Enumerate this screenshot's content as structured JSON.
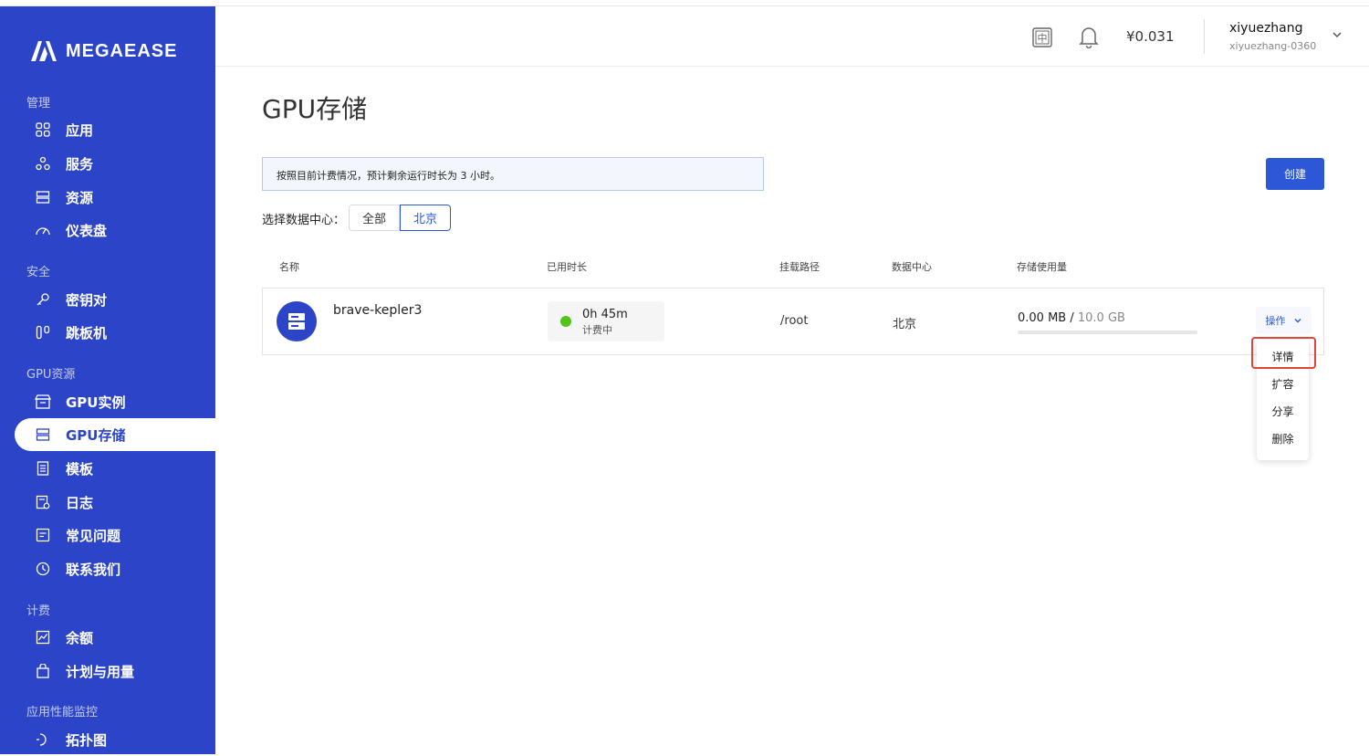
{
  "brand": {
    "name": "MEGAEASE"
  },
  "sidebar": {
    "sections": [
      {
        "title": "管理"
      },
      {
        "title": "安全"
      },
      {
        "title": "GPU资源"
      },
      {
        "title": "计费"
      },
      {
        "title": "应用性能监控"
      }
    ],
    "items": [
      {
        "label": "应用",
        "icon": "grid-icon"
      },
      {
        "label": "服务",
        "icon": "services-icon"
      },
      {
        "label": "资源",
        "icon": "server-icon"
      },
      {
        "label": "仪表盘",
        "icon": "gauge-icon"
      },
      {
        "label": "密钥对",
        "icon": "key-icon"
      },
      {
        "label": "跳板机",
        "icon": "jump-host-icon"
      },
      {
        "label": "GPU实例",
        "icon": "gpu-instance-icon"
      },
      {
        "label": "GPU存储",
        "icon": "storage-icon",
        "active": true
      },
      {
        "label": "模板",
        "icon": "template-icon"
      },
      {
        "label": "日志",
        "icon": "log-icon"
      },
      {
        "label": "常见问题",
        "icon": "faq-icon"
      },
      {
        "label": "联系我们",
        "icon": "clock-icon"
      },
      {
        "label": "余额",
        "icon": "chart-icon"
      },
      {
        "label": "计划与用量",
        "icon": "bag-icon"
      },
      {
        "label": "拓扑图",
        "icon": "topology-icon"
      }
    ]
  },
  "header": {
    "lang_icon_text": "中",
    "balance": "¥0.031",
    "username": "xiyuezhang",
    "user_id": "xiyuezhang-0360"
  },
  "main": {
    "title": "GPU存储",
    "notice": "按照目前计费情况，预计剩余运行时长为 3 小时。",
    "create_label": "创建",
    "datacenter_label": "选择数据中心：",
    "datacenter_options": [
      "全部",
      "北京"
    ],
    "datacenter_selected": "北京",
    "columns": [
      "名称",
      "已用时长",
      "挂载路径",
      "数据中心",
      "存储使用量"
    ],
    "rows": [
      {
        "name": "brave-kepler3",
        "runtime": "0h 45m",
        "status": "计费中",
        "mount_path": "/root",
        "datacenter": "北京",
        "used": "0.00 MB",
        "separator": " / ",
        "total": "10.0 GB",
        "usage_fraction": 0
      }
    ],
    "actions_label": "操作",
    "action_menu": [
      "详情",
      "扩容",
      "分享",
      "删除"
    ]
  },
  "colors": {
    "sidebar_bg": "#2c44c7",
    "accent": "#2c57d6",
    "status_running": "#52c41a",
    "highlight": "#e0453a"
  }
}
